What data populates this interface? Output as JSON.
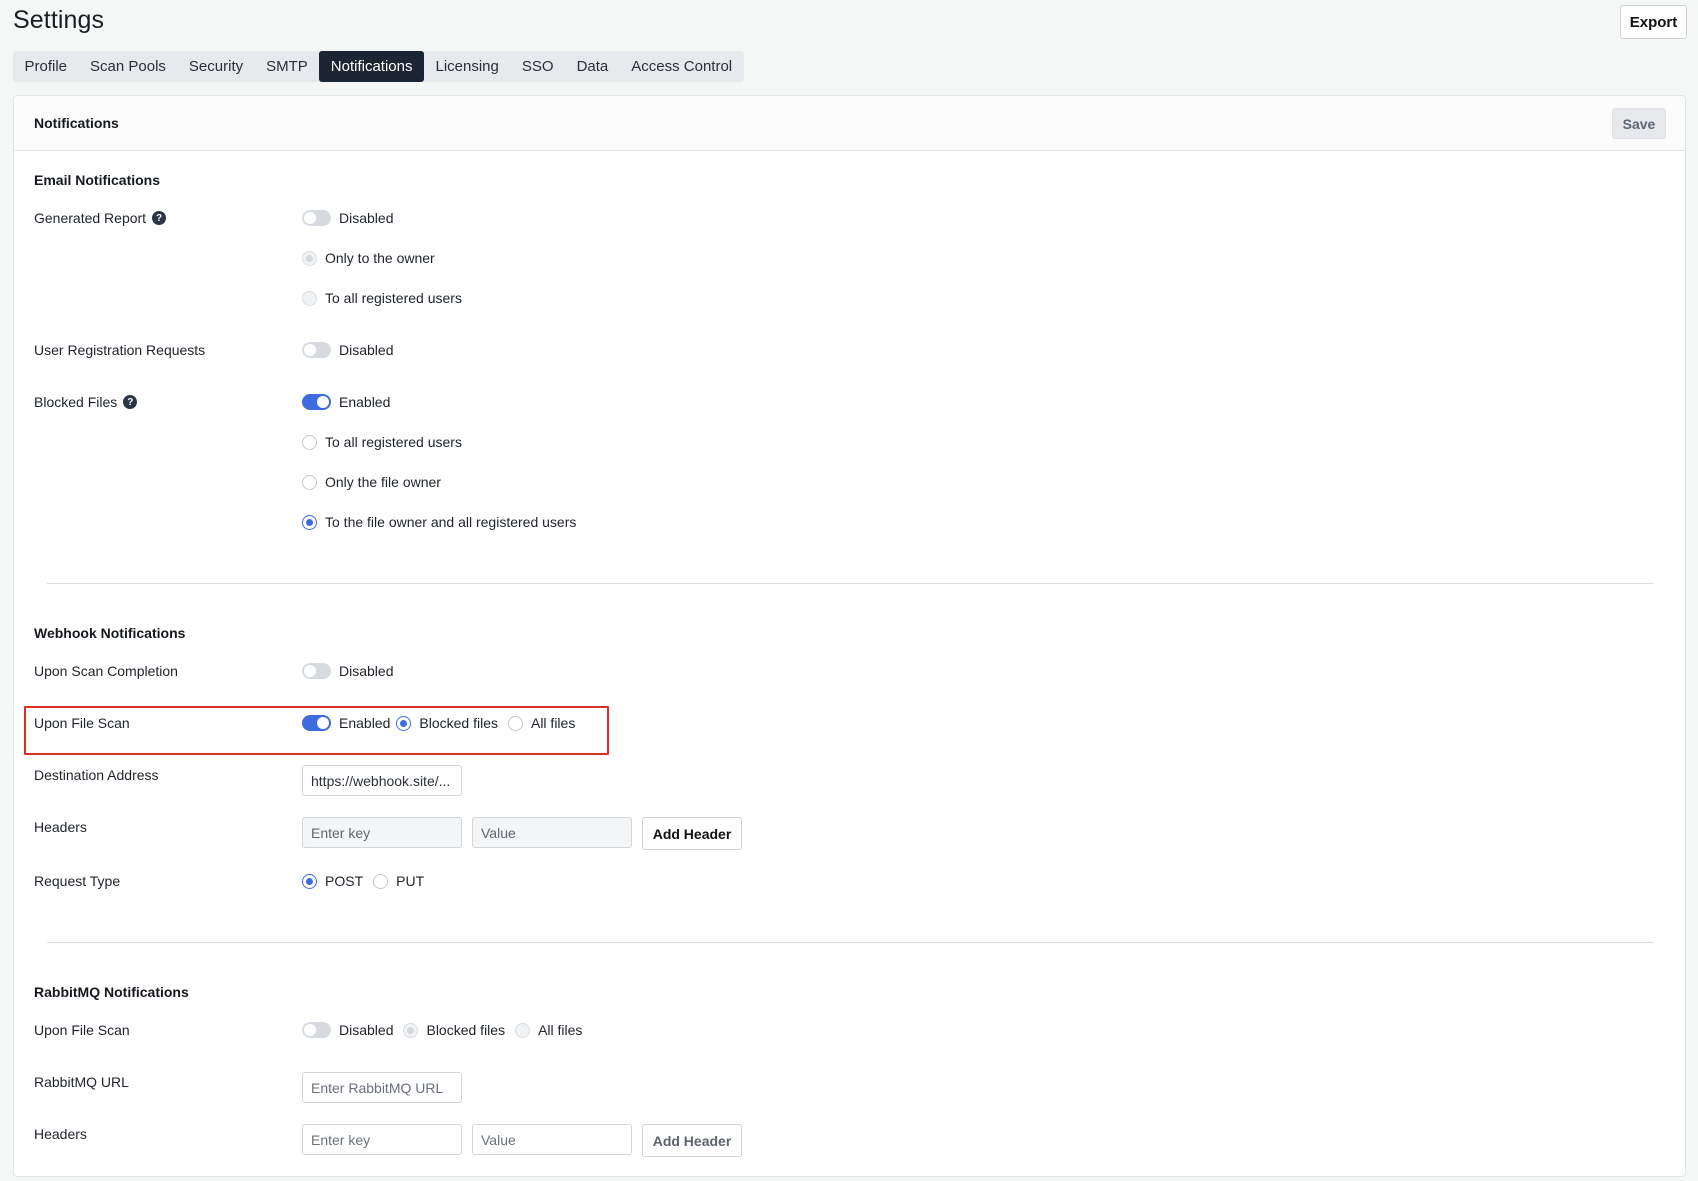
{
  "header": {
    "title": "Settings",
    "export_label": "Export"
  },
  "tabs": [
    {
      "label": "Profile",
      "active": false
    },
    {
      "label": "Scan Pools",
      "active": false
    },
    {
      "label": "Security",
      "active": false
    },
    {
      "label": "SMTP",
      "active": false
    },
    {
      "label": "Notifications",
      "active": true
    },
    {
      "label": "Licensing",
      "active": false
    },
    {
      "label": "SSO",
      "active": false
    },
    {
      "label": "Data",
      "active": false
    },
    {
      "label": "Access Control",
      "active": false
    }
  ],
  "card": {
    "title": "Notifications",
    "save_label": "Save"
  },
  "email": {
    "title": "Email Notifications",
    "generated_report": {
      "label": "Generated Report",
      "state": "Disabled",
      "options": [
        "Only to the owner",
        "To all registered users"
      ],
      "selected": "Only to the owner"
    },
    "user_registration": {
      "label": "User Registration Requests",
      "state": "Disabled"
    },
    "blocked_files": {
      "label": "Blocked Files",
      "state": "Enabled",
      "options": [
        "To all registered users",
        "Only the file owner",
        "To the file owner and all registered users"
      ],
      "selected": "To the file owner and all registered users"
    }
  },
  "webhook": {
    "title": "Webhook Notifications",
    "scan_completion": {
      "label": "Upon Scan Completion",
      "state": "Disabled"
    },
    "file_scan": {
      "label": "Upon File Scan",
      "state": "Enabled",
      "options": [
        "Blocked files",
        "All files"
      ],
      "selected": "Blocked files"
    },
    "destination": {
      "label": "Destination Address",
      "value": "https://webhook.site/..."
    },
    "headers": {
      "label": "Headers",
      "key_placeholder": "Enter key",
      "value_placeholder": "Value",
      "add_label": "Add Header"
    },
    "request_type": {
      "label": "Request Type",
      "options": [
        "POST",
        "PUT"
      ],
      "selected": "POST"
    }
  },
  "rabbitmq": {
    "title": "RabbitMQ Notifications",
    "file_scan": {
      "label": "Upon File Scan",
      "state": "Disabled",
      "options": [
        "Blocked files",
        "All files"
      ],
      "selected": "Blocked files"
    },
    "url": {
      "label": "RabbitMQ URL",
      "placeholder": "Enter RabbitMQ URL"
    },
    "headers": {
      "label": "Headers",
      "key_placeholder": "Enter key",
      "value_placeholder": "Value",
      "add_label": "Add Header"
    }
  },
  "icons": {
    "help": "question-circle-icon",
    "help_glyph": "?"
  },
  "colors": {
    "accent": "#3e6ce0",
    "tab_active": "#1c2533",
    "highlight": "#d93025"
  }
}
